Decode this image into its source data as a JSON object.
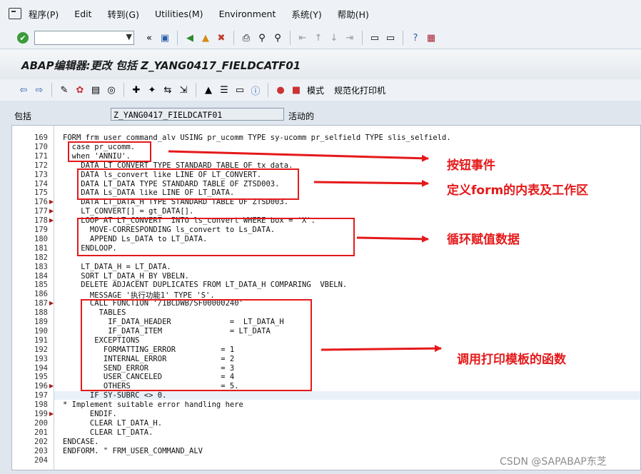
{
  "menu": {
    "items": [
      "程序(P)",
      "Edit",
      "转到(G)",
      "Utilities(M)",
      "Environment",
      "系统(Y)",
      "帮助(H)"
    ]
  },
  "title": "ABAP编辑器:更改 包括 Z_YANG0417_FIELDCATF01",
  "toolbar2": {
    "mode_label": "模式",
    "print_label": "规范化打印机"
  },
  "package": {
    "label": "包括",
    "value": "Z_YANG0417_FIELDCATF01",
    "status": "活动的"
  },
  "code_lines": [
    {
      "n": "169",
      "t": "FORM frm_user_command_alv USING pr_ucomm TYPE sy-ucomm pr_selfield TYPE slis_selfield."
    },
    {
      "n": "170",
      "t": "  case pr_ucomm."
    },
    {
      "n": "171",
      "t": "  when 'ANNIU'."
    },
    {
      "n": "172",
      "t": "    DATA LT_CONVERT TYPE STANDARD TABLE OF tx_data."
    },
    {
      "n": "173",
      "t": "    DATA ls_convert like LINE OF LT_CONVERT."
    },
    {
      "n": "174",
      "t": "    DATA LT_DATA TYPE STANDARD TABLE OF ZTSD003."
    },
    {
      "n": "175",
      "t": "    DATA Ls_DATA like LINE OF LT_DATA."
    },
    {
      "n": "176",
      "t": "    DATA LT_DATA_H TYPE STANDARD TABLE OF ZTSD003."
    },
    {
      "n": "177",
      "t": "    LT_CONVERT[] = gt_DATA[]."
    },
    {
      "n": "178",
      "t": "    LOOP AT LT_CONVERT  INTO ls_convert WHERE box = 'X'."
    },
    {
      "n": "179",
      "t": "      MOVE-CORRESPONDING ls_convert to Ls_DATA."
    },
    {
      "n": "180",
      "t": "      APPEND Ls_DATA to LT_DATA."
    },
    {
      "n": "181",
      "t": "    ENDLOOP."
    },
    {
      "n": "182",
      "t": ""
    },
    {
      "n": "183",
      "t": "    LT_DATA_H = LT_DATA."
    },
    {
      "n": "184",
      "t": "    SORT LT_DATA_H BY VBELN."
    },
    {
      "n": "185",
      "t": "    DELETE ADJACENT DUPLICATES FROM LT_DATA_H COMPARING  VBELN."
    },
    {
      "n": "186",
      "t": "      MESSAGE '执行功能1' TYPE 'S'."
    },
    {
      "n": "187",
      "t": "      CALL FUNCTION '/1BCDWB/SF00000240'"
    },
    {
      "n": "188",
      "t": "        TABLES"
    },
    {
      "n": "189",
      "t": "          IF_DATA_HEADER             =  LT_DATA_H"
    },
    {
      "n": "190",
      "t": "          IF_DATA_ITEM               = LT_DATA"
    },
    {
      "n": "191",
      "t": "       EXCEPTIONS"
    },
    {
      "n": "192",
      "t": "         FORMATTING_ERROR          = 1"
    },
    {
      "n": "193",
      "t": "         INTERNAL_ERROR            = 2"
    },
    {
      "n": "194",
      "t": "         SEND_ERROR                = 3"
    },
    {
      "n": "195",
      "t": "         USER_CANCELED             = 4"
    },
    {
      "n": "196",
      "t": "         OTHERS                    = 5."
    },
    {
      "n": "197",
      "t": "      IF SY-SUBRC <> 0."
    },
    {
      "n": "198",
      "t": "* Implement suitable error handling here"
    },
    {
      "n": "199",
      "t": "      ENDIF."
    },
    {
      "n": "200",
      "t": "      CLEAR LT_DATA_H."
    },
    {
      "n": "201",
      "t": "      CLEAR LT_DATA."
    },
    {
      "n": "202",
      "t": "ENDCASE."
    },
    {
      "n": "203",
      "t": "ENDFORM. \" FRM_USER_COMMAND_ALV"
    },
    {
      "n": "204",
      "t": ""
    }
  ],
  "annotations": {
    "a1": "按钮事件",
    "a2": "定义form的内表及工作区",
    "a3": "循环赋值数据",
    "a4": "调用打印模板的函数"
  },
  "watermark": "CSDN @SAPABAP东芝"
}
